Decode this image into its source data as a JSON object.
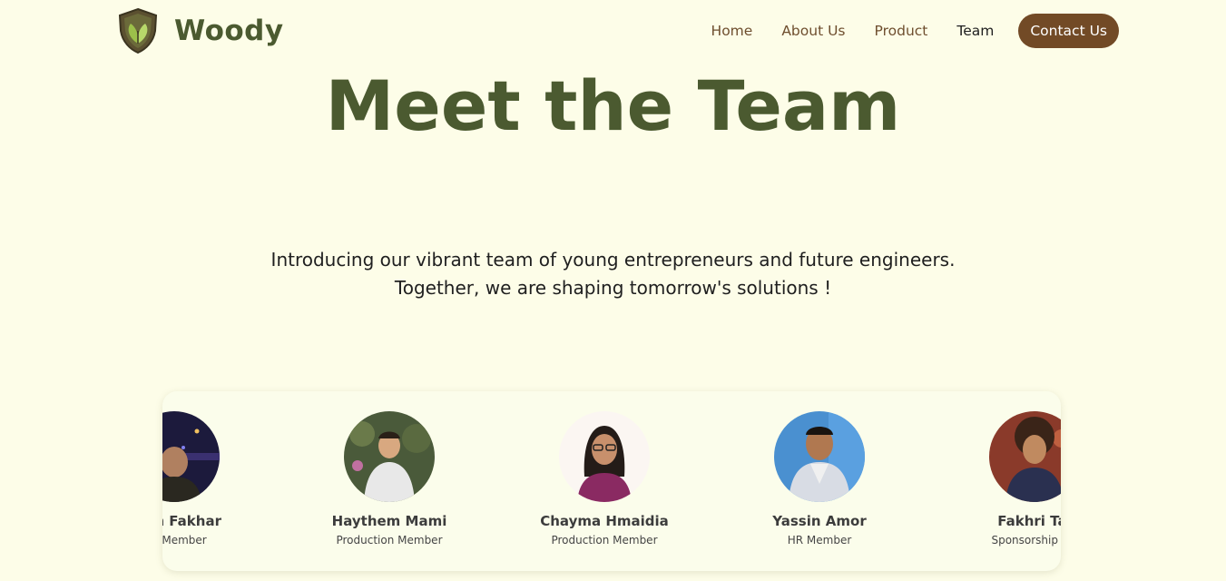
{
  "brand": {
    "name": "Woody",
    "logo_icon": "shield-leaf-icon",
    "colors": {
      "primary": "#4b5a30",
      "accent": "#724a26",
      "background": "#fdfde8"
    }
  },
  "nav": {
    "items": [
      {
        "label": "Home"
      },
      {
        "label": "About Us"
      },
      {
        "label": "Product"
      },
      {
        "label": "Team",
        "active": true
      }
    ],
    "contact_label": "Contact Us"
  },
  "hero": {
    "title": "Meet the Team",
    "intro_line1": "Introducing our vibrant team of young entrepreneurs and future engineers.",
    "intro_line2": "Together, we are shaping tomorrow's solutions !"
  },
  "team": {
    "members": [
      {
        "name": "alem Fakhar",
        "role": "ion Member"
      },
      {
        "name": "Haythem Mami",
        "role": "Production Member"
      },
      {
        "name": "Chayma Hmaidia",
        "role": "Production Member"
      },
      {
        "name": "Yassin Amor",
        "role": "HR Member"
      },
      {
        "name": "Fakhri Tal",
        "role": "Sponsorship Me"
      }
    ]
  }
}
